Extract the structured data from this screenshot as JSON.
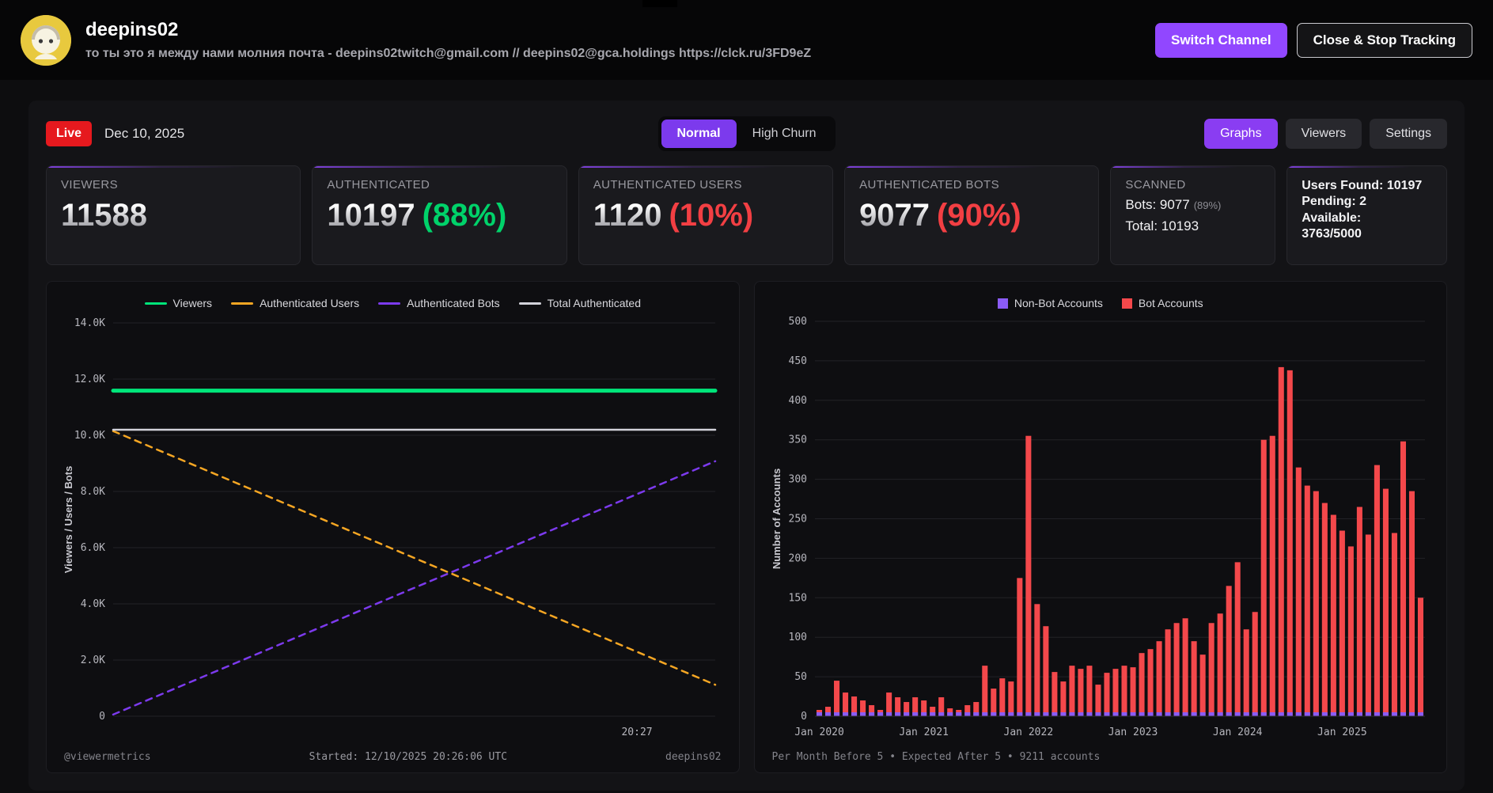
{
  "colors": {
    "accent": "#9147ff",
    "live": "#e6191e",
    "pct_green": "#00d26a",
    "pct_red": "#f23f43",
    "viewers_line": "#00e57a",
    "auth_users_line": "#f5a623",
    "auth_bots_line": "#7c3aed",
    "total_auth_line": "#d2d2da",
    "bot_bar": "#f4484b",
    "nonbot_bar": "#8b5cf6"
  },
  "header": {
    "channel_name": "deepins02",
    "channel_description": "то ты это я между нами молния почта - deepins02twitch@gmail.com // deepins02@gca.holdings https://clck.ru/3FD9eZ",
    "switch_channel_label": "Switch Channel",
    "close_stop_label": "Close & Stop Tracking"
  },
  "toolbar": {
    "live_label": "Live",
    "date": "Dec 10, 2025",
    "mode_normal": "Normal",
    "mode_high_churn": "High Churn",
    "tab_graphs": "Graphs",
    "tab_viewers": "Viewers",
    "tab_settings": "Settings"
  },
  "stats": {
    "viewers": {
      "label": "VIEWERS",
      "value": "11588"
    },
    "authenticated": {
      "label": "AUTHENTICATED",
      "value": "10197",
      "pct": "(88%)"
    },
    "auth_users": {
      "label": "AUTHENTICATED USERS",
      "value": "1120",
      "pct": "(10%)"
    },
    "auth_bots": {
      "label": "AUTHENTICATED BOTS",
      "value": "9077",
      "pct": "(90%)"
    },
    "scanned": {
      "label": "SCANNED",
      "bots_line": "Bots: 9077",
      "bots_pct": "(89%)",
      "total_line": "Total: 10193"
    },
    "summary": {
      "line1": "Users Found: 10197",
      "line2": "Pending: 2",
      "line3": "Available:",
      "line4": "3763/5000"
    }
  },
  "line_panel": {
    "footer_left": "@viewermetrics",
    "footer_center": "Started: 12/10/2025 20:26:06 UTC",
    "footer_right": "deepins02"
  },
  "bar_panel": {
    "footer": "Per Month Before 5 • Expected After 5 • 9211 accounts"
  },
  "chart_data": [
    {
      "type": "line",
      "title": "",
      "ylabel": "Viewers / Users / Bots",
      "ylim": [
        0,
        14000
      ],
      "grid": true,
      "legend_position": "top",
      "yticks": [
        [
          0,
          "0"
        ],
        [
          2000,
          "2.0K"
        ],
        [
          4000,
          "4.0K"
        ],
        [
          6000,
          "6.0K"
        ],
        [
          8000,
          "8.0K"
        ],
        [
          10000,
          "10.0K"
        ],
        [
          12000,
          "12.0K"
        ],
        [
          14000,
          "14.0K"
        ]
      ],
      "xticks": [
        "20:27"
      ],
      "xtick_pos": [
        0.87
      ],
      "series": [
        {
          "name": "Viewers",
          "color": "#00e57a",
          "style": "solid",
          "width": 5,
          "points": [
            [
              0,
              11588
            ],
            [
              1,
              11588
            ]
          ]
        },
        {
          "name": "Authenticated Users",
          "color": "#f5a623",
          "style": "dashed",
          "width": 2.5,
          "points": [
            [
              0,
              10150
            ],
            [
              1,
              1120
            ]
          ]
        },
        {
          "name": "Authenticated Bots",
          "color": "#7c3aed",
          "style": "dashed",
          "width": 2.5,
          "points": [
            [
              0,
              60
            ],
            [
              1,
              9077
            ]
          ]
        },
        {
          "name": "Total Authenticated",
          "color": "#d2d2da",
          "style": "solid",
          "width": 2.5,
          "points": [
            [
              0,
              10197
            ],
            [
              1,
              10197
            ]
          ]
        }
      ]
    },
    {
      "type": "bar",
      "title": "",
      "ylabel": "Number of Accounts",
      "ylim": [
        0,
        500
      ],
      "grid": true,
      "legend_position": "top",
      "yticks": [
        0,
        50,
        100,
        150,
        200,
        250,
        300,
        350,
        400,
        450,
        500
      ],
      "xticks": [
        "Jan 2020",
        "Jan 2021",
        "Jan 2022",
        "Jan 2023",
        "Jan 2024",
        "Jan 2025"
      ],
      "xtick_indices": [
        0,
        12,
        24,
        36,
        48,
        60
      ],
      "legend": [
        {
          "name": "Non-Bot Accounts",
          "color": "#8b5cf6"
        },
        {
          "name": "Bot Accounts",
          "color": "#f4484b"
        }
      ],
      "series": [
        {
          "name": "Non-Bot Accounts",
          "color": "#8b5cf6",
          "values": [
            5,
            5,
            5,
            5,
            5,
            5,
            5,
            5,
            5,
            5,
            5,
            5,
            5,
            5,
            5,
            5,
            5,
            5,
            5,
            5,
            5,
            5,
            5,
            5,
            5,
            5,
            5,
            5,
            5,
            5,
            5,
            5,
            5,
            5,
            5,
            5,
            5,
            5,
            5,
            5,
            5,
            5,
            5,
            5,
            5,
            5,
            5,
            5,
            5,
            5,
            5,
            5,
            5,
            5,
            5,
            5,
            5,
            5,
            5,
            5,
            5,
            5,
            5,
            5,
            5,
            5,
            5,
            5,
            5,
            5
          ]
        },
        {
          "name": "Bot Accounts",
          "color": "#f4484b",
          "values": [
            8,
            12,
            45,
            30,
            25,
            20,
            14,
            8,
            30,
            24,
            18,
            24,
            20,
            12,
            24,
            10,
            8,
            14,
            18,
            64,
            35,
            48,
            44,
            175,
            355,
            142,
            114,
            56,
            44,
            64,
            60,
            64,
            40,
            55,
            60,
            64,
            62,
            80,
            85,
            95,
            110,
            118,
            124,
            95,
            78,
            118,
            130,
            165,
            195,
            110,
            132,
            350,
            355,
            442,
            438,
            315,
            292,
            285,
            270,
            255,
            235,
            215,
            265,
            230,
            318,
            288,
            232,
            348,
            285,
            150
          ]
        }
      ]
    }
  ]
}
